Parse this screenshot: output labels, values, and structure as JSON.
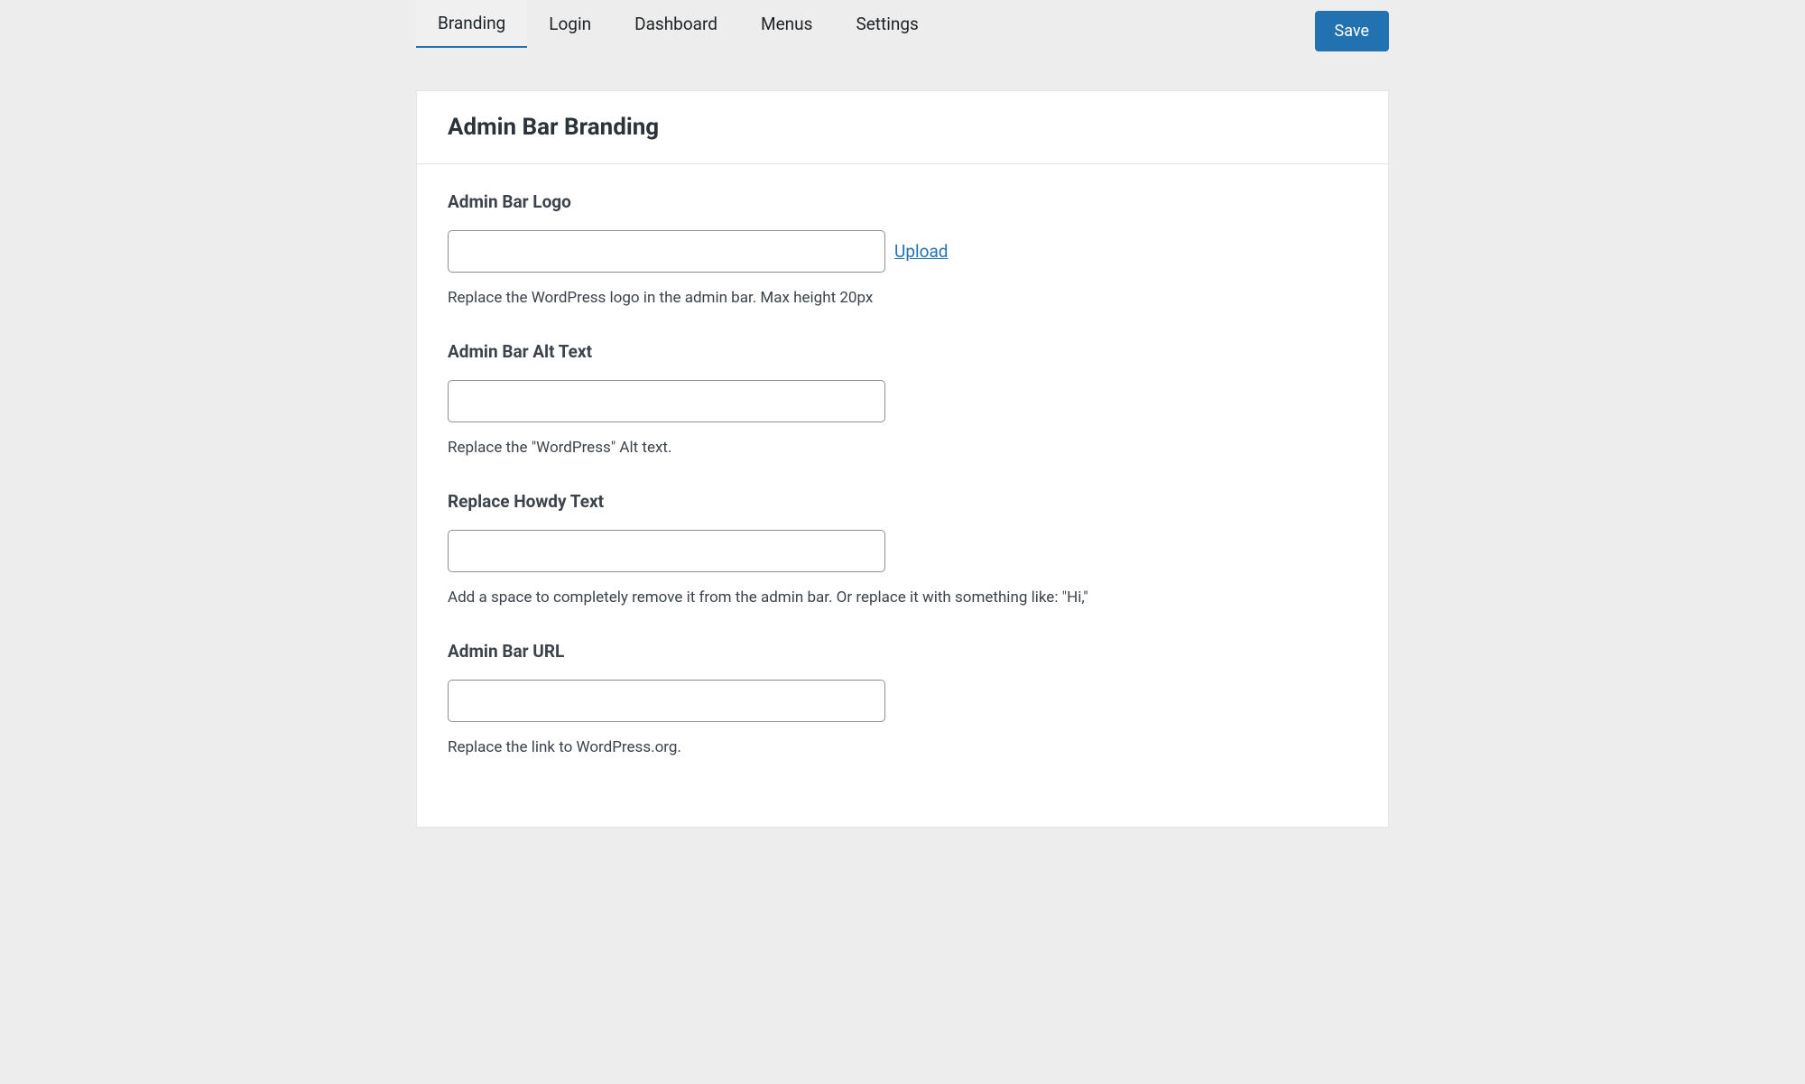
{
  "nav": {
    "tabs": [
      {
        "label": "Branding",
        "active": true
      },
      {
        "label": "Login",
        "active": false
      },
      {
        "label": "Dashboard",
        "active": false
      },
      {
        "label": "Menus",
        "active": false
      },
      {
        "label": "Settings",
        "active": false
      }
    ],
    "save_label": "Save"
  },
  "panel": {
    "title": "Admin Bar Branding",
    "fields": [
      {
        "label": "Admin Bar Logo",
        "value": "",
        "upload_label": "Upload",
        "has_upload": true,
        "description": "Replace the WordPress logo in the admin bar. Max height 20px"
      },
      {
        "label": "Admin Bar Alt Text",
        "value": "",
        "has_upload": false,
        "description": "Replace the \"WordPress\" Alt text."
      },
      {
        "label": "Replace Howdy Text",
        "value": "",
        "has_upload": false,
        "description": "Add a space to completely remove it from the admin bar. Or replace it with something like: \"Hi,\""
      },
      {
        "label": "Admin Bar URL",
        "value": "",
        "has_upload": false,
        "description": "Replace the link to WordPress.org."
      }
    ]
  }
}
